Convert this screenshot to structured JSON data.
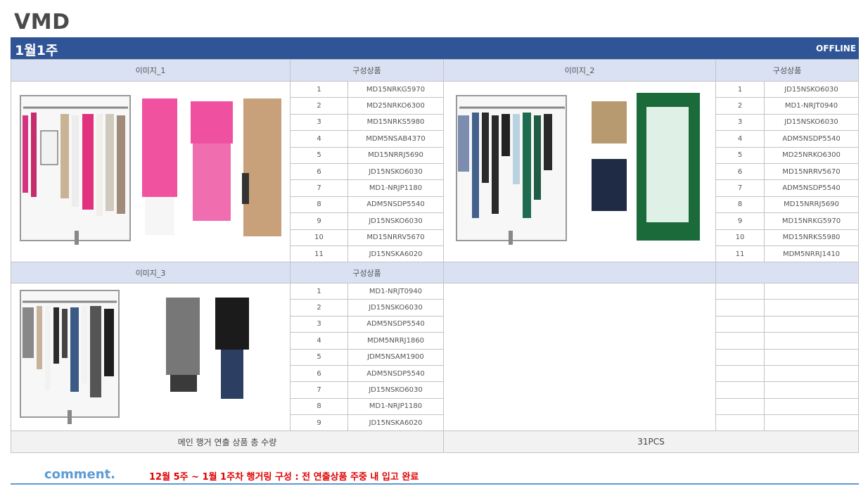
{
  "header": {
    "title": "VMD",
    "week": "1월1주",
    "channel": "OFFLINE"
  },
  "colors": {
    "bar": "#2f5597",
    "header_fill": "#d9e1f2",
    "comment_label": "#5b9bd5",
    "comment_text": "#e00000"
  },
  "sections": [
    {
      "image_label": "이미지_1",
      "items_label": "구성상품",
      "items": [
        {
          "no": "1",
          "code": "MD15NRKG5970"
        },
        {
          "no": "2",
          "code": "MD25NRKO6300"
        },
        {
          "no": "3",
          "code": "MD15NRKS5980"
        },
        {
          "no": "4",
          "code": "MDM5NSAB4370"
        },
        {
          "no": "5",
          "code": "MD15NRRJ5690"
        },
        {
          "no": "6",
          "code": "JD15NSKO6030"
        },
        {
          "no": "7",
          "code": "MD1-NRJP1180"
        },
        {
          "no": "8",
          "code": "ADM5NSDP5540"
        },
        {
          "no": "9",
          "code": "JD15NSKO6030"
        },
        {
          "no": "10",
          "code": "MD15NRRV5670"
        },
        {
          "no": "11",
          "code": "JD15NSKA6020"
        }
      ]
    },
    {
      "image_label": "이미지_2",
      "items_label": "구성상품",
      "items": [
        {
          "no": "1",
          "code": "JD15NSKO6030"
        },
        {
          "no": "2",
          "code": "MD1-NRJT0940"
        },
        {
          "no": "3",
          "code": "JD15NSKO6030"
        },
        {
          "no": "4",
          "code": "ADM5NSDP5540"
        },
        {
          "no": "5",
          "code": "MD25NRKO6300"
        },
        {
          "no": "6",
          "code": "MD15NRRV5670"
        },
        {
          "no": "7",
          "code": "ADM5NSDP5540"
        },
        {
          "no": "8",
          "code": "MD15NRRJ5690"
        },
        {
          "no": "9",
          "code": "MD15NRKG5970"
        },
        {
          "no": "10",
          "code": "MD15NRKS5980"
        },
        {
          "no": "11",
          "code": "MDM5NRRJ1410"
        }
      ]
    },
    {
      "image_label": "이미지_3",
      "items_label": "구성상품",
      "items": [
        {
          "no": "1",
          "code": "MD1-NRJT0940"
        },
        {
          "no": "2",
          "code": "JD15NSKO6030"
        },
        {
          "no": "3",
          "code": "ADM5NSDP5540"
        },
        {
          "no": "4",
          "code": "MDM5NRRJ1860"
        },
        {
          "no": "5",
          "code": "JDM5NSAM1900"
        },
        {
          "no": "6",
          "code": "ADM5NSDP5540"
        },
        {
          "no": "7",
          "code": "JD15NSKO6030"
        },
        {
          "no": "8",
          "code": "MD1-NRJP1180"
        },
        {
          "no": "9",
          "code": "JD15NSKA6020"
        }
      ]
    }
  ],
  "footer": {
    "total_label": "메인 행거 연출 상품 총 수량",
    "total_value": "31PCS"
  },
  "comment": {
    "label": "comment.",
    "text": "12월 5주 ~ 1월 1주차 행거링 구성 : 전 연출상품 주중 내 입고 완료"
  }
}
